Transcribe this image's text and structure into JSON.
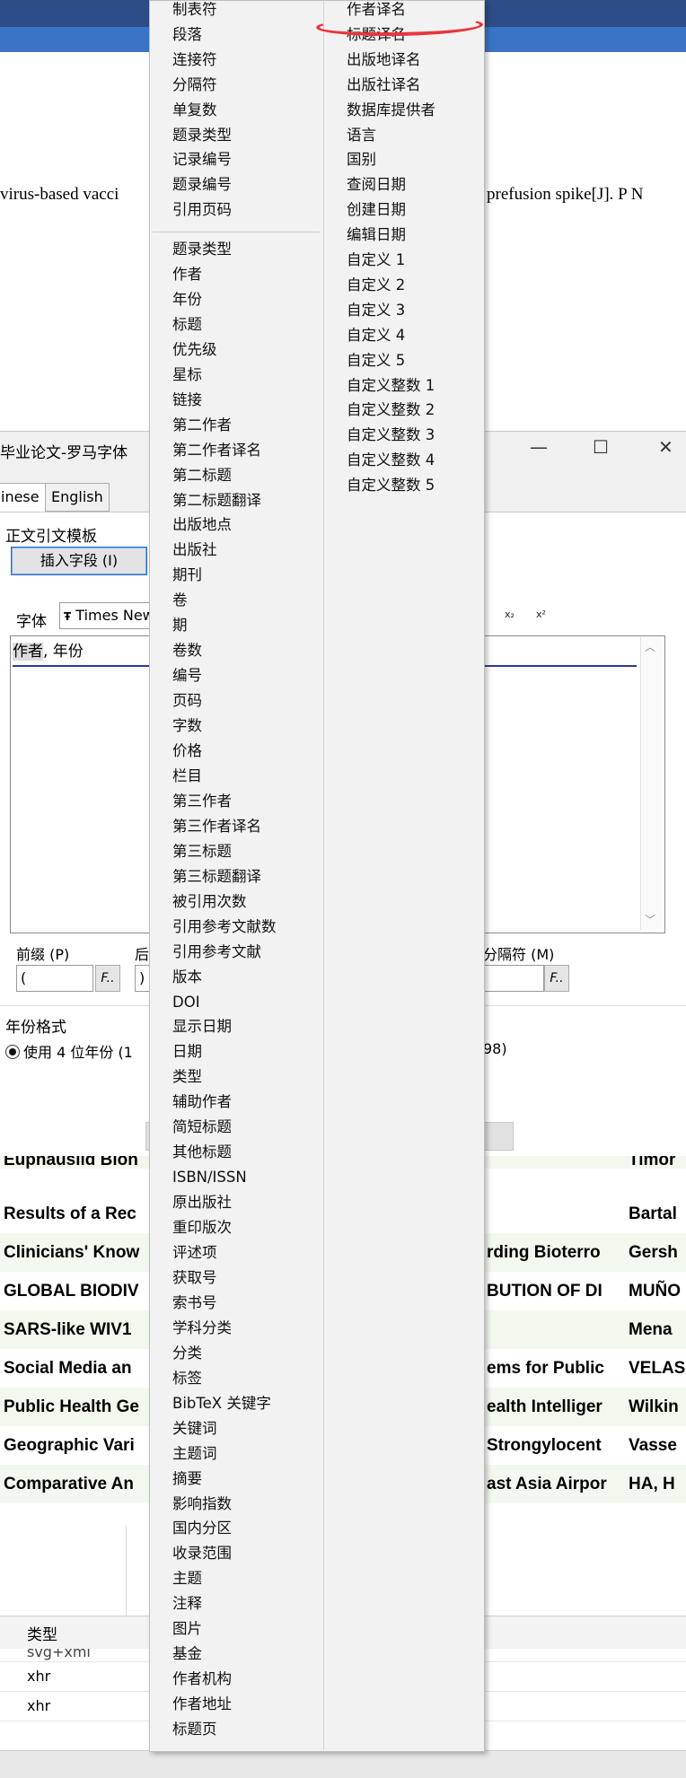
{
  "doc": {
    "text_left": "virus-based vacci",
    "text_right": "prefusion spike[J]. P N"
  },
  "dialog": {
    "title": "毕业论文-罗马字体",
    "tabs": [
      "inese",
      "English"
    ],
    "group_label": "正文引文模板",
    "insert_button": "插入字段 (I)",
    "font_label": "字体",
    "font_value": "Times New",
    "subscript_label": "x₂",
    "superscript_label": "x²",
    "template_value": {
      "highlight": "作者",
      "rest": ", 年份"
    },
    "prefix_label": "前缀 (P)",
    "prefix_value": "(",
    "suffix_label": "后",
    "suffix_value": ")",
    "separator_label": "分隔符 (M)",
    "fbutton": "F..",
    "year_format_label": "年份格式",
    "radio_text_left": "使用 4 位年份 (1",
    "radio_text_right": "98)",
    "window_buttons": {
      "minimize": "—",
      "maximize": "☐",
      "close": "✕"
    }
  },
  "table_rows": [
    {
      "c1": "Euphausiid Bion",
      "c2": "",
      "c3": "Timor"
    },
    {
      "c1": "Results of a Rec",
      "c2": "",
      "c3": "Bartal"
    },
    {
      "c1": "Clinicians' Know",
      "c2": "rding Bioterro",
      "c3": "Gersh"
    },
    {
      "c1": "GLOBAL BIODIV",
      "c2": "BUTION OF DI",
      "c3": "MUÑO"
    },
    {
      "c1": "SARS-like WIV1",
      "c2": "",
      "c3": "Mena"
    },
    {
      "c1": "Social Media an",
      "c2": "ems for Public",
      "c3": "VELAS"
    },
    {
      "c1": "Public Health Ge",
      "c2": "ealth Intelliger",
      "c3": "Wilkin"
    },
    {
      "c1": "Geographic Vari",
      "c2": "Strongylocent",
      "c3": "Vasse"
    },
    {
      "c1": "Comparative An",
      "c2": "ast Asia Airpor",
      "c3": "HA, H"
    }
  ],
  "network": {
    "header": "类型",
    "rows": [
      "svg+xml",
      "xhr",
      "xhr"
    ]
  },
  "menu": {
    "col1_top": [
      "制表符",
      "段落",
      "连接符",
      "分隔符",
      "单复数",
      "题录类型",
      "记录编号",
      "题录编号",
      "引用页码"
    ],
    "col1_bottom": [
      "题录类型",
      "作者",
      "年份",
      "标题",
      "优先级",
      "星标",
      "链接",
      "第二作者",
      "第二作者译名",
      "第二标题",
      "第二标题翻译",
      "出版地点",
      "出版社",
      "期刊",
      "卷",
      "期",
      "卷数",
      "编号",
      "页码",
      "字数",
      "价格",
      "栏目",
      "第三作者",
      "第三作者译名",
      "第三标题",
      "第三标题翻译",
      "被引用次数",
      "引用参考文献数",
      "引用参考文献",
      "版本",
      "DOI",
      "显示日期",
      "日期",
      "类型",
      "辅助作者",
      "简短标题",
      "其他标题",
      "ISBN/ISSN",
      "原出版社",
      "重印版次",
      "评述项",
      "获取号",
      "索书号",
      "学科分类",
      "分类",
      "标签",
      "BibTeX 关键字",
      "关键词",
      "主题词",
      "摘要",
      "影响指数",
      "国内分区",
      "收录范围",
      "主题",
      "注释",
      "图片",
      "基金",
      "作者机构",
      "作者地址",
      "标题页"
    ],
    "col2": [
      "作者译名",
      "标题译名",
      "出版地译名",
      "出版社译名",
      "数据库提供者",
      "语言",
      "国别",
      "查阅日期",
      "创建日期",
      "编辑日期",
      "自定义 1",
      "自定义 2",
      "自定义 3",
      "自定义 4",
      "自定义 5",
      "自定义整数 1",
      "自定义整数 2",
      "自定义整数 3",
      "自定义整数 4",
      "自定义整数 5"
    ],
    "highlight_color": "#e8353d"
  }
}
